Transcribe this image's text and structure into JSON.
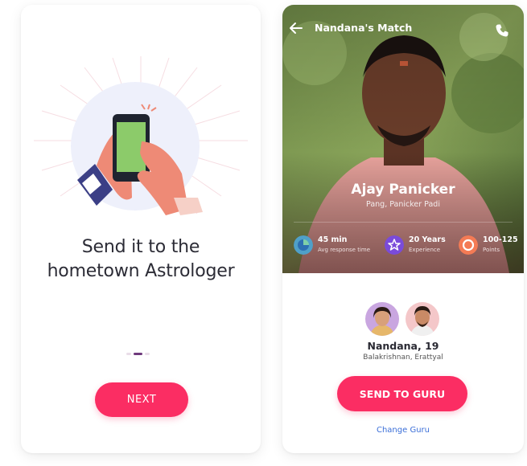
{
  "onboarding": {
    "title_line1": "Send it to the",
    "title_line2": "hometown Astrologer",
    "pager": {
      "pages": 3,
      "active_index": 1
    },
    "next_label": "NEXT"
  },
  "match_screen": {
    "header_title": "Nandana's Match",
    "astrologer": {
      "name": "Ajay Panicker",
      "location": "Pang, Panicker Padi"
    },
    "stats": [
      {
        "value": "45 min",
        "label": "Avg response time",
        "icon": "clock-icon",
        "color": "#4fa0c9"
      },
      {
        "value": "20 Years",
        "label": "Experience",
        "icon": "star-badge-icon",
        "color": "#7a4bd9"
      },
      {
        "value": "100-125",
        "label": "Points",
        "icon": "points-ring-icon",
        "color": "#f47b55"
      }
    ],
    "user": {
      "name": "Nandana, 19",
      "location": "Balakrishnan, Erattyal"
    },
    "send_label": "SEND TO GURU",
    "change_label": "Change Guru"
  },
  "colors": {
    "accent": "#fb2d63",
    "link": "#3b6fd8",
    "pager_active": "#6f3a7c"
  }
}
